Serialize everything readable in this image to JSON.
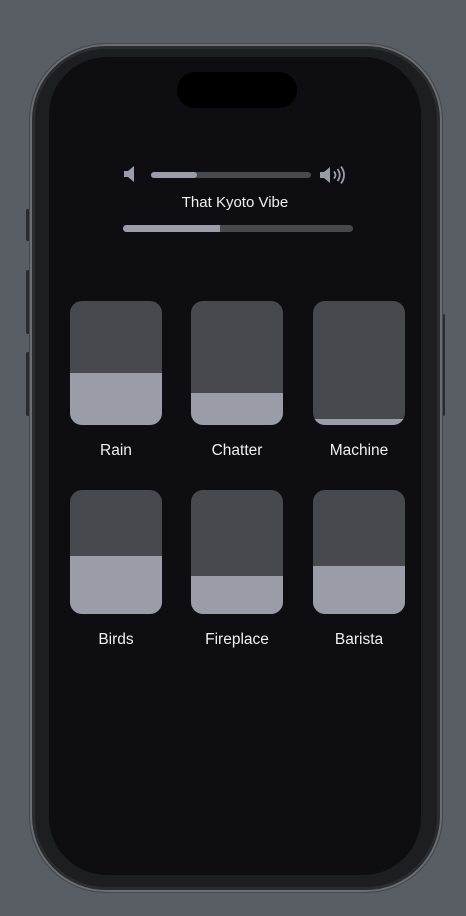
{
  "player": {
    "volume_level": 0.29,
    "track_title": "That Kyoto Vibe",
    "track_progress": 0.42
  },
  "sounds": [
    {
      "label": "Rain",
      "level": 0.42
    },
    {
      "label": "Chatter",
      "level": 0.26
    },
    {
      "label": "Machine",
      "level": 0.05
    },
    {
      "label": "Birds",
      "level": 0.47
    },
    {
      "label": "Fireplace",
      "level": 0.31
    },
    {
      "label": "Barista",
      "level": 0.39
    }
  ],
  "colors": {
    "background": "#595e65",
    "screen": "#0e0e12",
    "track": "#48484f",
    "fill": "#9a9ca8",
    "text": "#eef0f4"
  },
  "icons": [
    "speaker-low-icon",
    "speaker-high-icon"
  ]
}
